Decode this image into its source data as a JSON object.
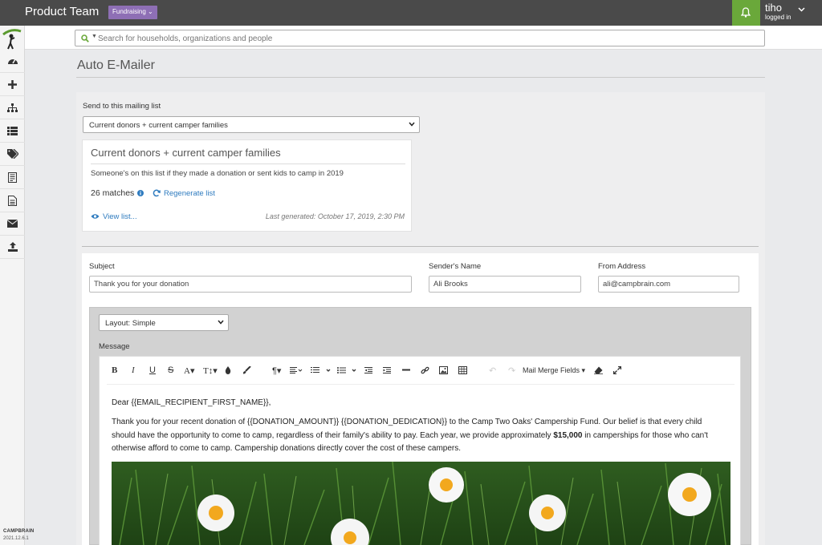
{
  "header": {
    "app_title": "Product Team",
    "team_badge": "Fundraising",
    "user_name": "tiho",
    "user_status": "logged in"
  },
  "sidebar": {
    "items": [
      "dashboard",
      "add",
      "org-chart",
      "list",
      "tags",
      "forms",
      "document",
      "email",
      "upload"
    ],
    "brand": "CAMPBRAIN",
    "version": "2021.12.6.1"
  },
  "search": {
    "placeholder": "Search for households, organizations and people"
  },
  "page": {
    "title": "Auto E-Mailer"
  },
  "mailing_list": {
    "label": "Send to this mailing list",
    "selected": "Current donors + current camper families",
    "card_title": "Current donors + current camper families",
    "description": "Someone's on this list if they made a donation or sent kids to camp in 2019",
    "matches": "26 matches",
    "regenerate": "Regenerate list",
    "view_list": "View list...",
    "last_generated": "Last generated: October 17, 2019, 2:30 PM"
  },
  "email_form": {
    "subject_label": "Subject",
    "subject_value": "Thank you for your donation",
    "sender_label": "Sender's Name",
    "sender_value": "Ali Brooks",
    "from_label": "From Address",
    "from_value": "ali@campbrain.com",
    "layout_selected": "Layout: Simple",
    "message_label": "Message"
  },
  "toolbar": {
    "mail_merge": "Mail Merge Fields"
  },
  "message": {
    "greeting": "Dear {{EMAIL_RECIPIENT_FIRST_NAME}},",
    "line1": "Thank you for your recent donation of {{DONATION_AMOUNT}} {{DONATION_DEDICATION}} to the Camp Two Oaks' Campership Fund. Our belief is that every child",
    "line2_pre": "should have the opportunity to come to camp, regardless of their family's ability to pay. Each year, we provide approximately ",
    "line2_bold": "$15,000",
    "line2_post": " in camperships for those who can't",
    "line3": "otherwise afford to come to camp. Campership donations directly cover the cost of these campers."
  },
  "colors": {
    "topbar": "#4a4a4a",
    "badge": "#8e6fb5",
    "notification": "#6aa83a",
    "link": "#2e7bbf"
  }
}
